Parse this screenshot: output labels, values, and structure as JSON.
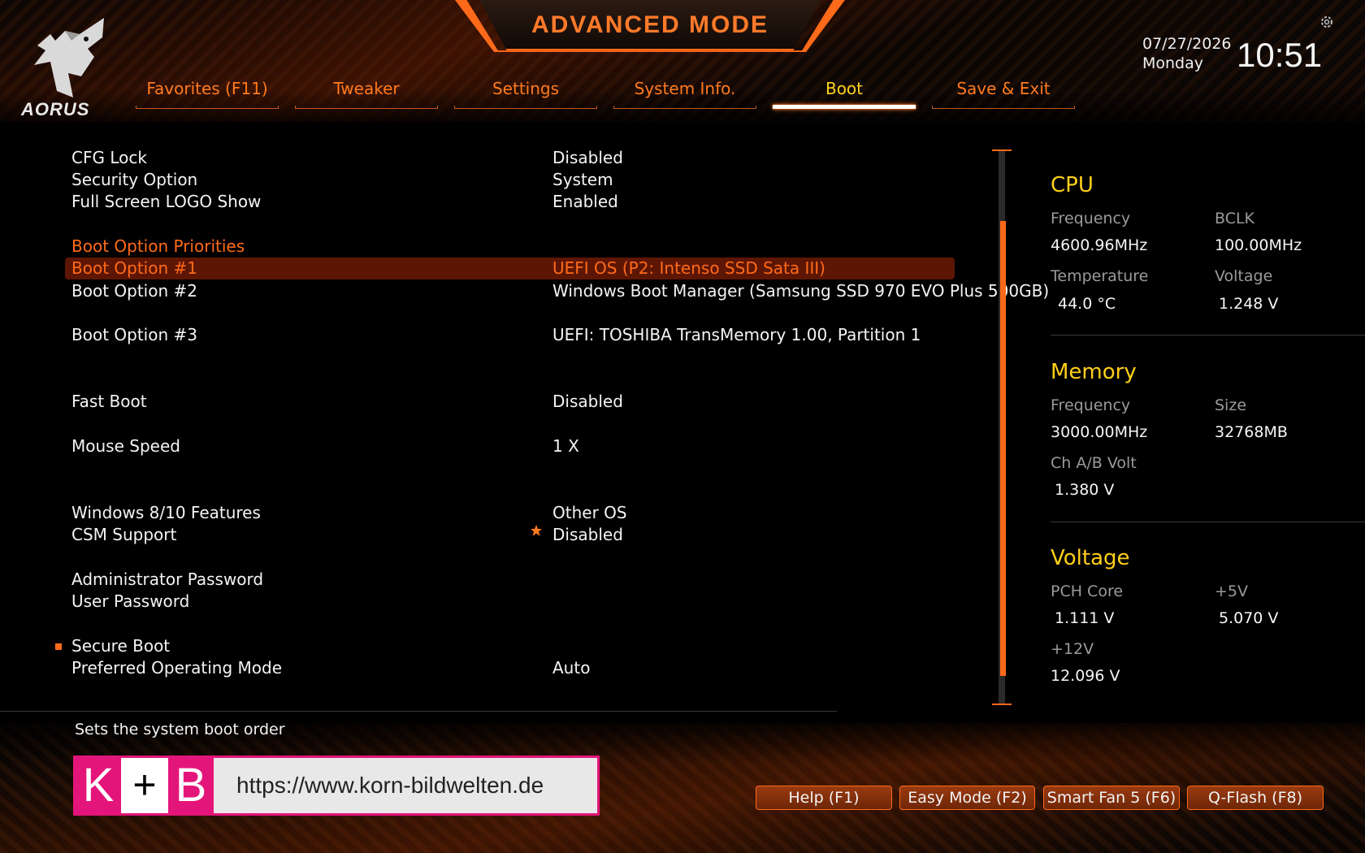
{
  "header": {
    "title": "ADVANCED MODE",
    "brand": "AORUS",
    "date": "07/27/2026",
    "weekday": "Monday",
    "time": "10:51"
  },
  "tabs": [
    {
      "label": "Favorites (F11)"
    },
    {
      "label": "Tweaker"
    },
    {
      "label": "Settings"
    },
    {
      "label": "System Info."
    },
    {
      "label": "Boot",
      "active": true
    },
    {
      "label": "Save & Exit"
    }
  ],
  "boot": {
    "cfg_lock": {
      "name": "CFG Lock",
      "value": "Disabled"
    },
    "security_option": {
      "name": "Security Option",
      "value": "System"
    },
    "logo_show": {
      "name": "Full Screen LOGO Show",
      "value": "Enabled"
    },
    "priorities_heading": "Boot Option Priorities",
    "boot1": {
      "name": "Boot Option #1",
      "value": "UEFI OS (P2: Intenso SSD Sata III)"
    },
    "boot2": {
      "name": "Boot Option #2",
      "value": "Windows Boot Manager (Samsung SSD 970 EVO Plus 500GB)"
    },
    "boot3": {
      "name": "Boot Option #3",
      "value": "UEFI: TOSHIBA TransMemory 1.00, Partition 1"
    },
    "fast_boot": {
      "name": "Fast Boot",
      "value": "Disabled"
    },
    "mouse_speed": {
      "name": "Mouse Speed",
      "value": "1 X"
    },
    "win_features": {
      "name": "Windows 8/10 Features",
      "value": "Other OS"
    },
    "csm": {
      "name": "CSM Support",
      "value": "Disabled"
    },
    "admin_pw": {
      "name": "Administrator Password"
    },
    "user_pw": {
      "name": "User Password"
    },
    "secure_boot": {
      "name": "Secure Boot"
    },
    "preferred_mode": {
      "name": "Preferred Operating Mode",
      "value": "Auto"
    }
  },
  "help_text": "Sets the system boot order",
  "cpu": {
    "heading": "CPU",
    "freq_label": "Frequency",
    "freq": "4600.96MHz",
    "bclk_label": "BCLK",
    "bclk": "100.00MHz",
    "temp_label": "Temperature",
    "temp": "44.0 °C",
    "volt_label": "Voltage",
    "volt": "1.248 V"
  },
  "memory": {
    "heading": "Memory",
    "freq_label": "Frequency",
    "freq": "3000.00MHz",
    "size_label": "Size",
    "size": "32768MB",
    "chvolt_label": "Ch A/B Volt",
    "chvolt": "1.380 V"
  },
  "voltage": {
    "heading": "Voltage",
    "pch_label": "PCH Core",
    "pch": "1.111 V",
    "v5_label": "+5V",
    "v5": "5.070 V",
    "v12_label": "+12V",
    "v12": "12.096 V"
  },
  "watermark": {
    "k": "K",
    "plus": "+",
    "b": "B",
    "url": "https://www.korn-bildwelten.de"
  },
  "footer_buttons": [
    {
      "label": "Help (F1)"
    },
    {
      "label": "Easy Mode (F2)"
    },
    {
      "label": "Smart Fan 5 (F6)"
    },
    {
      "label": "Q-Flash (F8)"
    }
  ],
  "colors": {
    "accent": "#ff6a1a",
    "heading_yellow": "#ffcf1a",
    "selected_row": "#5e1604"
  },
  "icons": [
    "aorus-eagle-icon",
    "gear-icon",
    "star-icon"
  ]
}
